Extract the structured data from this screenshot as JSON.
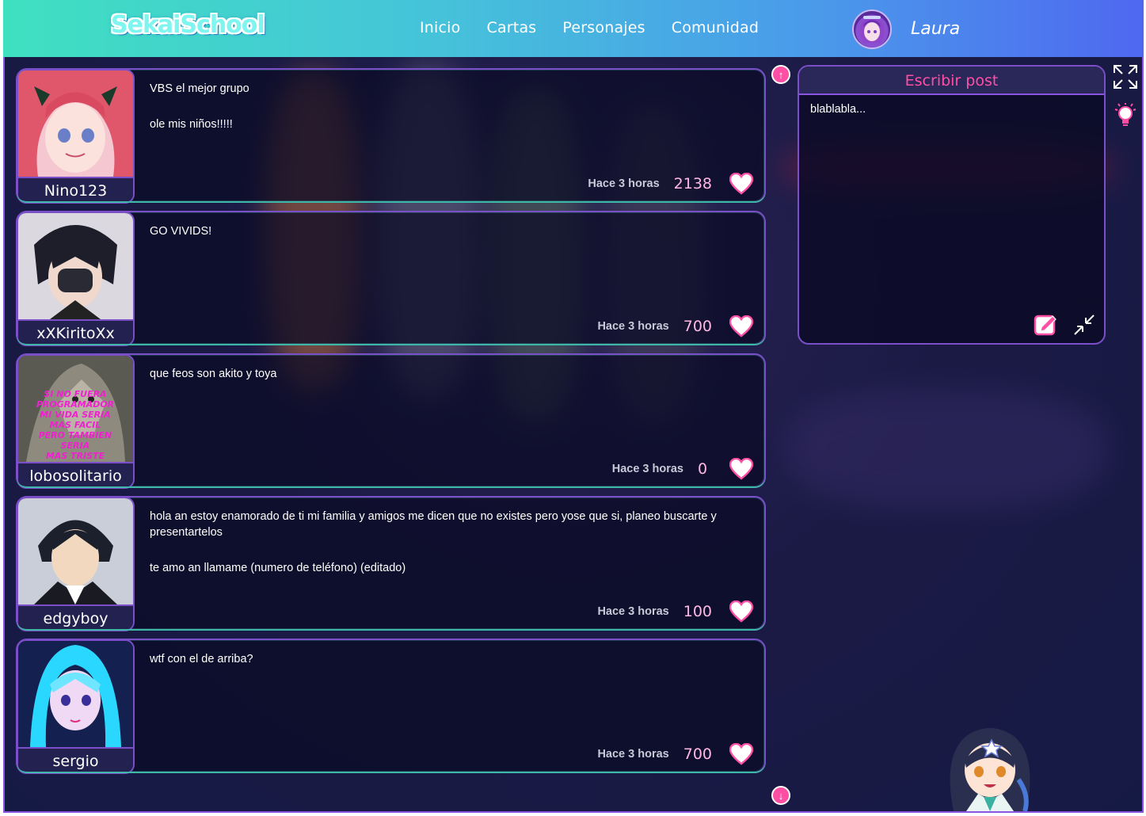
{
  "header": {
    "logo": "SekaiSchool",
    "nav": [
      "Inicio",
      "Cartas",
      "Personajes",
      "Comunidad"
    ],
    "user_name": "Laura"
  },
  "posts": [
    {
      "author": "Nino123",
      "paragraphs": [
        "VBS el mejor grupo",
        "ole mis niños!!!!!"
      ],
      "time": "Hace 3 horas",
      "likes": "2138",
      "avatar_colors": [
        "#f4a6b8",
        "#e05a6a",
        "#5a3a2f"
      ]
    },
    {
      "author": "xXKiritoXx",
      "paragraphs": [
        "GO VIVIDS!"
      ],
      "time": "Hace 3 horas",
      "likes": "700",
      "avatar_colors": [
        "#e8e2ea",
        "#222230",
        "#d9b8a8"
      ]
    },
    {
      "author": "lobosolitario",
      "paragraphs": [
        "que feos son akito y toya"
      ],
      "time": "Hace 3 horas",
      "likes": "0",
      "avatar_colors": [
        "#5a5a52",
        "#9b9688",
        "#f020d0"
      ],
      "avatar_caption": [
        "SI NO FUERA",
        "PROGRAMADOR",
        "MI VIDA SERIA",
        "MAS FACIL",
        "PERO TAMBIEN",
        "SERIA",
        "MAS TRISTE"
      ]
    },
    {
      "author": "edgyboy",
      "paragraphs": [
        "hola an estoy enamorado de ti mi familia y amigos me dicen que no existes pero yose que si, planeo buscarte y presentartelos",
        "te amo an llamame (numero de teléfono) (editado)"
      ],
      "time": "Hace 3 horas",
      "likes": "100",
      "avatar_colors": [
        "#cfd4dc",
        "#1c1f2c",
        "#f3d8c0"
      ]
    },
    {
      "author": "sergio",
      "paragraphs": [
        "wtf con el de arriba?"
      ],
      "time": "Hace 3 horas",
      "likes": "700",
      "avatar_colors": [
        "#2ad8ff",
        "#14204f",
        "#f0d9f5"
      ]
    }
  ],
  "compose": {
    "title": "Escribir post",
    "placeholder": "blablabla..."
  },
  "icons": {
    "accent": "#ff4fa5",
    "heart": "heart-icon",
    "expand": "expand-icon",
    "collapse": "collapse-icon",
    "edit": "edit-icon",
    "lightbulb": "lightbulb-icon",
    "scroll_up": "arrow-up-icon",
    "scroll_down": "arrow-down-icon"
  }
}
